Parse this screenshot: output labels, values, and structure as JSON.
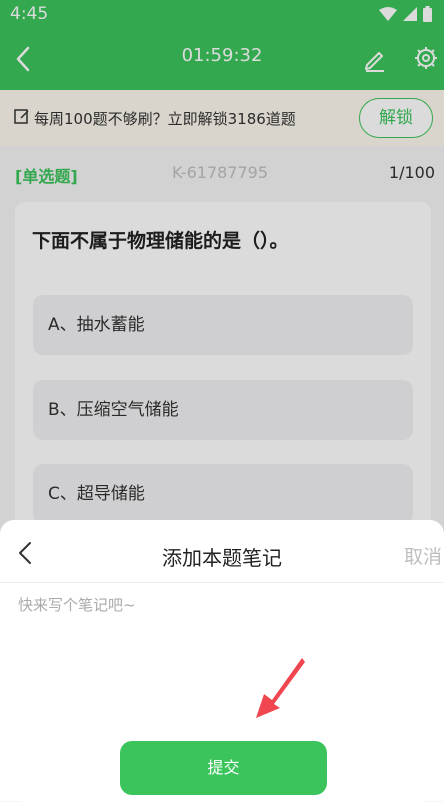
{
  "status_bar": {
    "time": "4:45"
  },
  "app_bar": {
    "timer": "01:59:32"
  },
  "promo": {
    "text": "每周100题不够刷？立即解锁3186道题",
    "unlock_label": "解锁"
  },
  "question": {
    "type_label": "[单选题]",
    "id": "K-61787795",
    "progress": "1/100",
    "text": "下面不属于物理储能的是（）。",
    "options": [
      "A、抽水蓄能",
      "B、压缩空气储能",
      "C、超导储能"
    ]
  },
  "note_sheet": {
    "title": "添加本题笔记",
    "cancel_label": "取消",
    "placeholder": "快来写个笔记吧~",
    "submit_label": "提交"
  },
  "colors": {
    "accent": "#3cc45c",
    "arrow": "#f0464f"
  }
}
